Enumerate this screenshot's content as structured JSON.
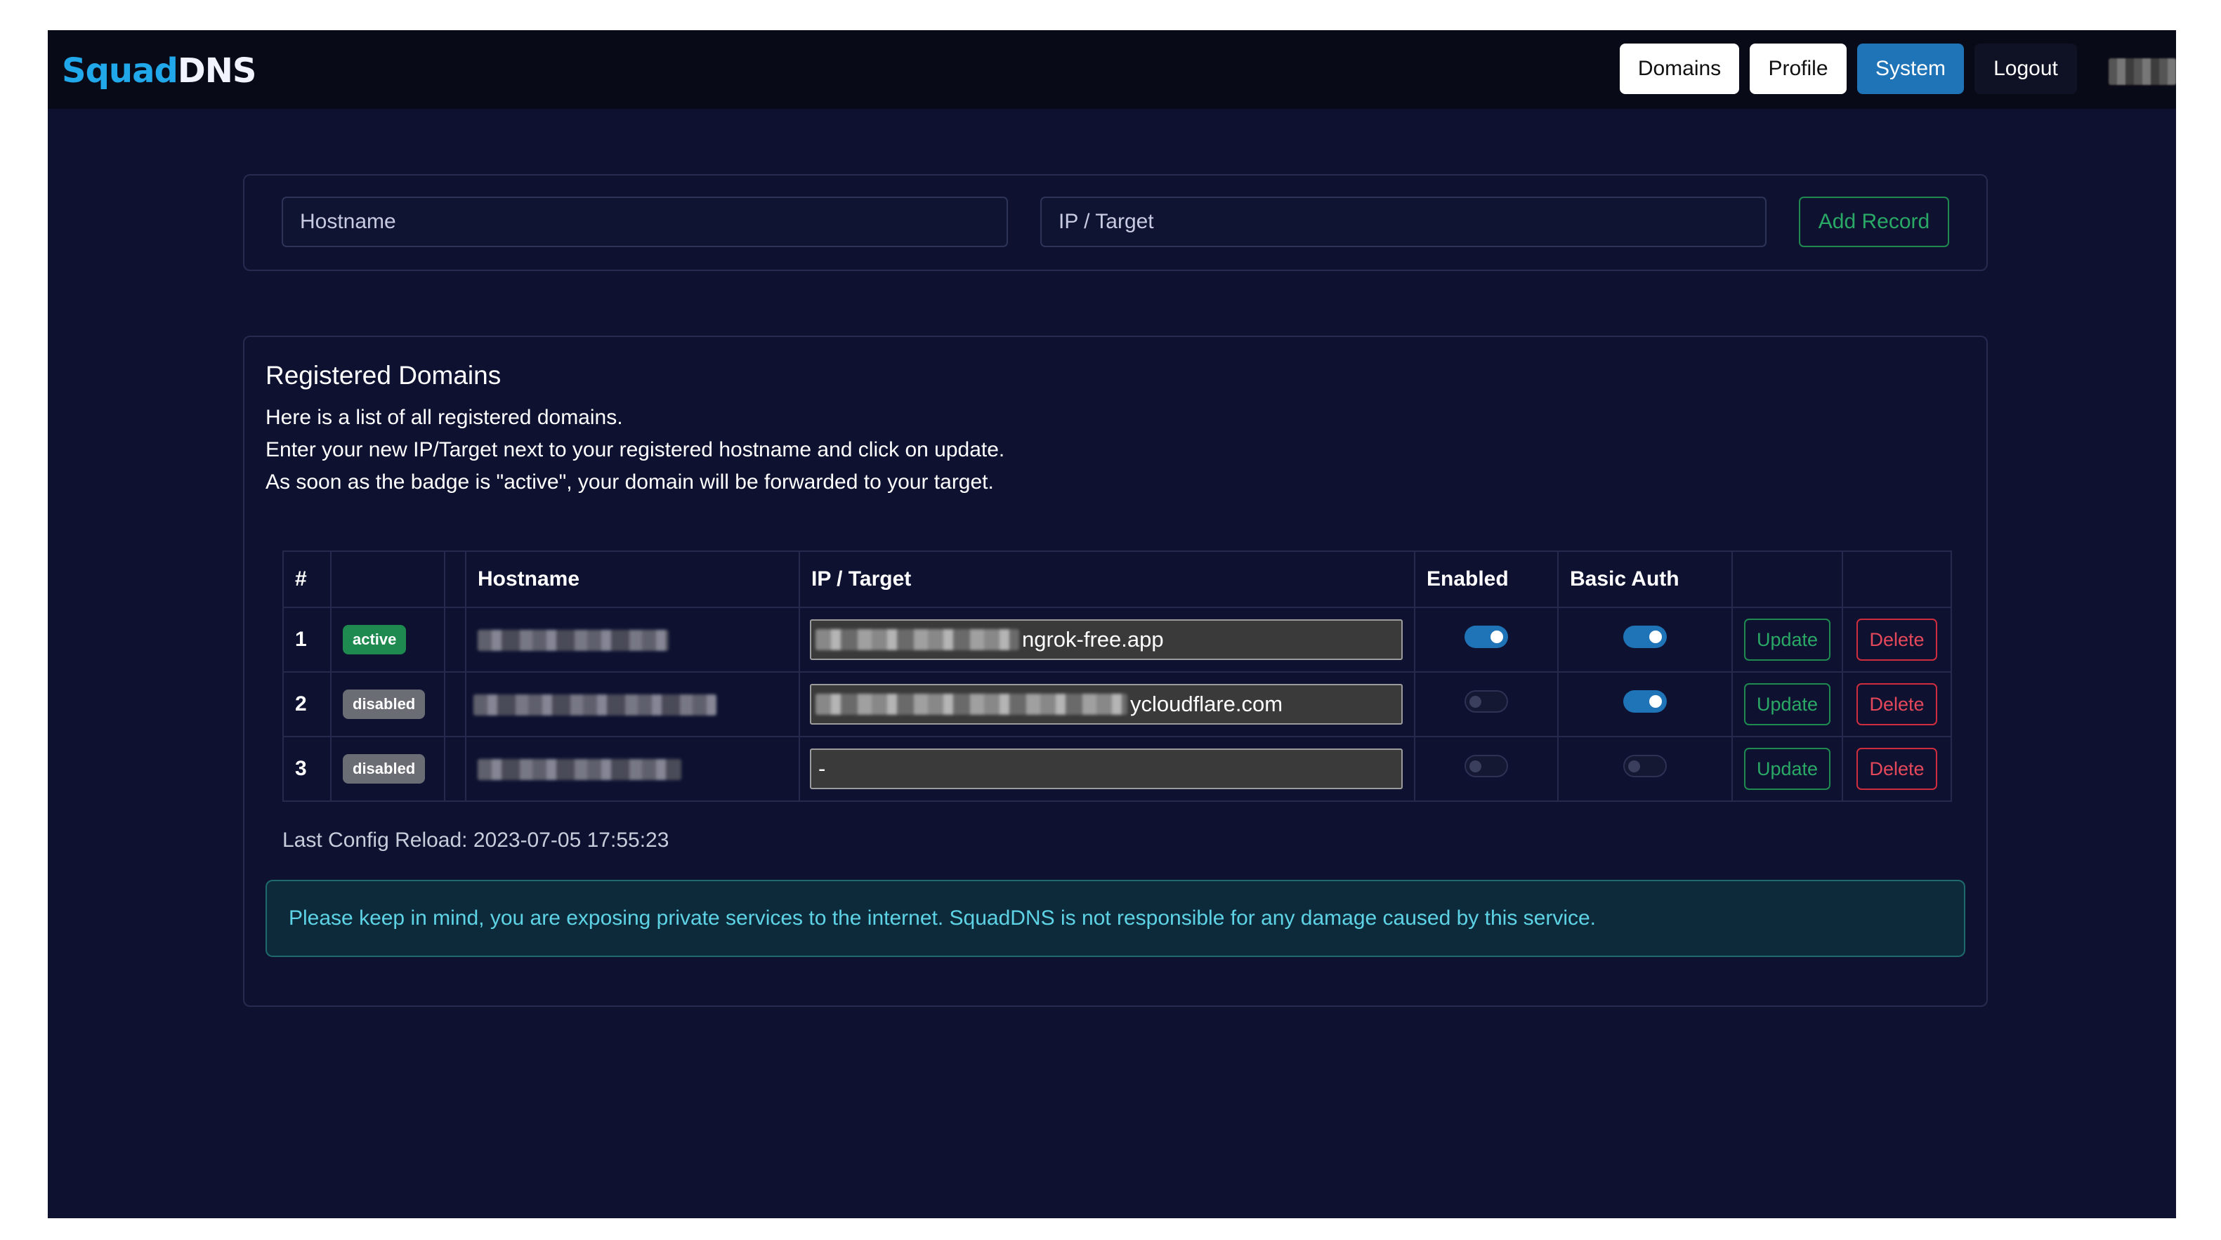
{
  "brand": {
    "part1": "Squad",
    "part2": "DNS"
  },
  "nav": {
    "domains": "Domains",
    "profile": "Profile",
    "system": "System",
    "logout": "Logout"
  },
  "add_record": {
    "hostname_placeholder": "Hostname",
    "target_placeholder": "IP / Target",
    "add_label": "Add Record"
  },
  "domains": {
    "title": "Registered Domains",
    "desc1": "Here is a list of all registered domains.",
    "desc2": "Enter your new IP/Target next to your registered hostname and click on update.",
    "desc3": "As soon as the badge is \"active\", your domain will be forwarded to your target.",
    "columns": {
      "num": "#",
      "hostname": "Hostname",
      "target": "IP / Target",
      "enabled": "Enabled",
      "basic_auth": "Basic Auth"
    },
    "rows": [
      {
        "num": "1",
        "badge": "active",
        "target_suffix": "ngrok-free.app",
        "enabled": true,
        "basic_auth": true,
        "update": "Update",
        "delete": "Delete"
      },
      {
        "num": "2",
        "badge": "disabled",
        "target_suffix": "ycloudflare.com",
        "enabled": false,
        "basic_auth": true,
        "update": "Update",
        "delete": "Delete"
      },
      {
        "num": "3",
        "badge": "disabled",
        "target_suffix": "-",
        "enabled": false,
        "basic_auth": false,
        "update": "Update",
        "delete": "Delete"
      }
    ],
    "last_reload": "Last Config Reload: 2023-07-05 17:55:23",
    "warning": "Please keep in mind, you are exposing private services to the internet. SquadDNS is not responsible for any damage caused by this service."
  },
  "colors": {
    "background": "#0e1230",
    "navbar": "#090a17",
    "primary": "#1f73b7",
    "success": "#1e8a4f",
    "danger": "#cf2d3d",
    "info_text": "#5fd3e6"
  }
}
